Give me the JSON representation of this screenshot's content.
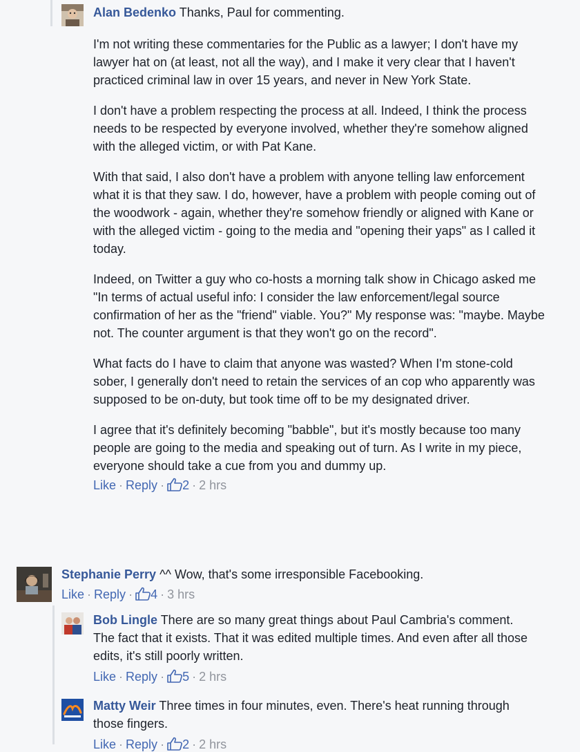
{
  "comments": [
    {
      "author": "Alan Bedenko",
      "first_line": "Thanks, Paul for commenting.",
      "paragraphs": [
        "I'm not writing these commentaries for the Public as a lawyer; I don't have my lawyer hat on (at least, not all the way), and I make it very clear that I haven't practiced criminal law in over 15 years, and never in New York State.",
        "I don't have a problem respecting the process at all. Indeed, I think the process needs to be respected by everyone involved, whether they're somehow aligned with the alleged victim, or with Pat Kane.",
        "With that said, I also don't have a problem with anyone telling law enforcement what it is that they saw. I do, however, have a problem with people coming out of the woodwork - again, whether they're somehow friendly or aligned with Kane or with the alleged victim - going to the media and \"opening their yaps\" as I called it today.",
        "Indeed, on Twitter a guy who co-hosts a morning talk show in Chicago asked me \"In terms of actual useful info: I consider the law enforcement/legal source confirmation of her as the \"friend\" viable. You?\" My response was: \"maybe. Maybe not. The counter argument is that they won't go on the record\".",
        "What facts do I have to claim that anyone was wasted? When I'm stone-cold sober, I generally don't need to retain the services of an cop who apparently was supposed to be on-duty, but took time off to be my designated driver.",
        "I agree that it's definitely becoming \"babble\", but it's mostly because too many people are going to the media and speaking out of turn. As I write in my piece, everyone should take a cue from you and dummy up."
      ],
      "like_label": "Like",
      "reply_label": "Reply",
      "likes": "2",
      "time": "2 hrs"
    },
    {
      "author": "Stephanie Perry",
      "first_line": "^^ Wow, that's some irresponsible Facebooking.",
      "like_label": "Like",
      "reply_label": "Reply",
      "likes": "4",
      "time": "3 hrs"
    },
    {
      "author": "Bob Lingle",
      "first_line": "There are so many great things about Paul Cambria's comment. The fact that it exists. That it was edited multiple times. And even after all those edits, it's still poorly written.",
      "like_label": "Like",
      "reply_label": "Reply",
      "likes": "5",
      "time": "2 hrs"
    },
    {
      "author": "Matty Weir",
      "first_line": "Three times in four minutes, even. There's heat running through those fingers.",
      "like_label": "Like",
      "reply_label": "Reply",
      "likes": "2",
      "time": "2 hrs"
    }
  ],
  "separator": "·",
  "colors": {
    "author": "#365899",
    "link": "#4267b2",
    "meta": "#90949c",
    "text": "#1d2129",
    "background": "#f6f7f9"
  }
}
